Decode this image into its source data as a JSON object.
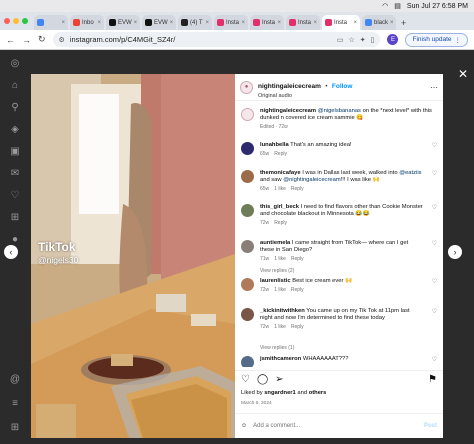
{
  "menubar": {
    "date_time": "Sun Jul 27  6:58 PM"
  },
  "browser": {
    "tabs": [
      {
        "label": "",
        "color": "#4285f4",
        "active": false
      },
      {
        "label": "Inbo",
        "color": "#ea4335",
        "active": false
      },
      {
        "label": "EVW",
        "color": "#111111",
        "active": false
      },
      {
        "label": "EVW",
        "color": "#111111",
        "active": false
      },
      {
        "label": "(4) T",
        "color": "#222222",
        "active": false
      },
      {
        "label": "Insta",
        "color": "#e1306c",
        "active": false
      },
      {
        "label": "Insta",
        "color": "#e1306c",
        "active": false
      },
      {
        "label": "Insta",
        "color": "#e1306c",
        "active": false
      },
      {
        "label": "Insta",
        "color": "#e1306c",
        "active": true
      },
      {
        "label": "black",
        "color": "#4285f4",
        "active": false
      }
    ],
    "new_tab": "+",
    "url": "instagram.com/p/C4MGit_SZ4r/",
    "profile_initial": "E",
    "update_label": "Finish update"
  },
  "post": {
    "author": "nightingaleicecream",
    "follow_label": "Follow",
    "audio": "Original audio",
    "dot": "•",
    "caption_author": "nightingaleicecream",
    "caption_mention": "@nigelsbananas",
    "caption_text": " on the *next level* with this dunked n covered ice cream sammie 😋",
    "caption_meta": "Edited · 72w",
    "video_watermark": "TikTok",
    "video_handle": "@nigels30",
    "liked_by_prefix": "Liked by ",
    "liked_by_user": "sngardner1",
    "liked_by_suffix": " and ",
    "liked_by_others": "others",
    "date": "March 6, 2024",
    "add_comment_placeholder": "Add a comment...",
    "post_label": "Post"
  },
  "comments": [
    {
      "user": "lunahbella",
      "text": " That's an amazing idea!",
      "time": "65w",
      "likes": "",
      "reply": "Reply",
      "color": "#2d2a6e"
    },
    {
      "user": "themonicafaye",
      "text": " I was in Dallas last week, walked into ",
      "mention1": "@eatziis",
      "mid": " and saw ",
      "mention2": "@nightingaleicecream",
      "end": "!!! I was like 🙌",
      "time": "65w",
      "likes": "1 like",
      "reply": "Reply",
      "color": "#9c6b4a"
    },
    {
      "user": "this_girl_beck",
      "text": " I need to find flavors other than Cookie Monster and chocolate blackout in Minnesota 😂😂",
      "time": "72w",
      "likes": "",
      "reply": "Reply",
      "color": "#6e7d57"
    },
    {
      "user": "auntiemela",
      "text": " I came straight from TikTok— where can I get these in San Diego?",
      "time": "71w",
      "likes": "1 like",
      "reply": "Reply",
      "color": "#8a7f78",
      "view_replies": "View replies (2)"
    },
    {
      "user": "laurenlistic",
      "text": " Best ice cream ever 🙌",
      "time": "72w",
      "likes": "1 like",
      "reply": "Reply",
      "color": "#b07a5a"
    },
    {
      "user": "_kickinitwithken",
      "text": " You came up on my Tik Tok at 11pm last night and now I'm determined to find these today",
      "time": "72w",
      "likes": "1 like",
      "reply": "Reply",
      "color": "#7a5548",
      "view_replies": "View replies (1)"
    },
    {
      "user": "jsmithcameron",
      "text": " WHAAAAAAT???",
      "time": "",
      "likes": "",
      "reply": "",
      "color": "#556b8a"
    }
  ],
  "icons": {
    "close": "close-icon",
    "prev": "chevron-left-icon",
    "next": "chevron-right-icon",
    "heart": "heart-icon",
    "comment": "comment-icon",
    "share": "share-icon",
    "save": "bookmark-icon"
  }
}
